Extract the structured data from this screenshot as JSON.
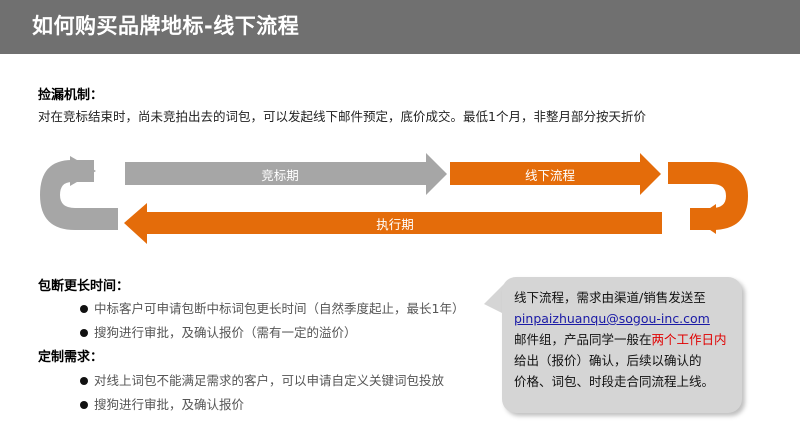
{
  "header": {
    "title": "如何购买品牌地标-线下流程"
  },
  "capture": {
    "label": "捡漏机制：",
    "text": "对在竞标结束时，尚未竞拍出去的词包，可以发起线下邮件预定，底价成交。最低1个月，非整月部分按天折价"
  },
  "flow": {
    "bidding_label": "竞标期",
    "offline_label": "线下流程",
    "execution_label": "执行期",
    "colors": {
      "gray": "#a6a6a6",
      "orange": "#e46c0a"
    }
  },
  "longer": {
    "label": "包断更长时间：",
    "items": [
      "中标客户可申请包断中标词包更长时间（自然季度起止，最长1年）",
      "搜狗进行审批，及确认报价（需有一定的溢价）"
    ]
  },
  "custom": {
    "label": "定制需求：",
    "items": [
      "对线上词包不能满足需求的客户，可以申请自定义关键词包投放",
      "搜狗进行审批，及确认报价"
    ]
  },
  "callout": {
    "line1": "线下流程，需求由渠道/销售发送至",
    "email": "pinpaizhuanqu@sogou-inc.com",
    "line3_a": "邮件组，产品同学一般在",
    "highlight": "两个工作日内",
    "line4_b": "给出（报价）确认，后续以确认的",
    "line5": "价格、词包、时段走合同流程上线。"
  }
}
